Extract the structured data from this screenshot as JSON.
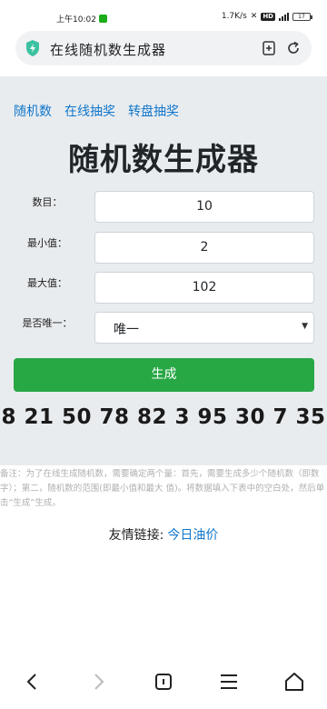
{
  "status_bar": {
    "time": "上午10:02",
    "speed": "1.7K/s",
    "hd": "HD",
    "battery": "17"
  },
  "address_bar": {
    "title": "在线随机数生成器"
  },
  "top_links": [
    "随机数",
    "在线抽奖",
    "转盘抽奖"
  ],
  "page_title": "随机数生成器",
  "form": {
    "count_label": "数目：",
    "count_value": "10",
    "min_label": "最小值：",
    "min_value": "2",
    "max_label": "最大值：",
    "max_value": "102",
    "unique_label": "是否唯一：",
    "unique_value": "唯一"
  },
  "generate_label": "生成",
  "result": "8 21 50 78 82 3 95 30 7 35",
  "note": "备注：为了在线生成随机数，需要确定两个量：首先，需要生成多少个随机数（即数字）；第二，随机数的范围(即最小值和最大 值)。将数据填入下表中的空白处，然后单击“生成”生成。",
  "friend_links": {
    "label": "友情链接:",
    "link": "今日油价"
  },
  "colors": {
    "accent": "#1177cc",
    "button": "#28a745",
    "panel": "#e9ecef"
  }
}
